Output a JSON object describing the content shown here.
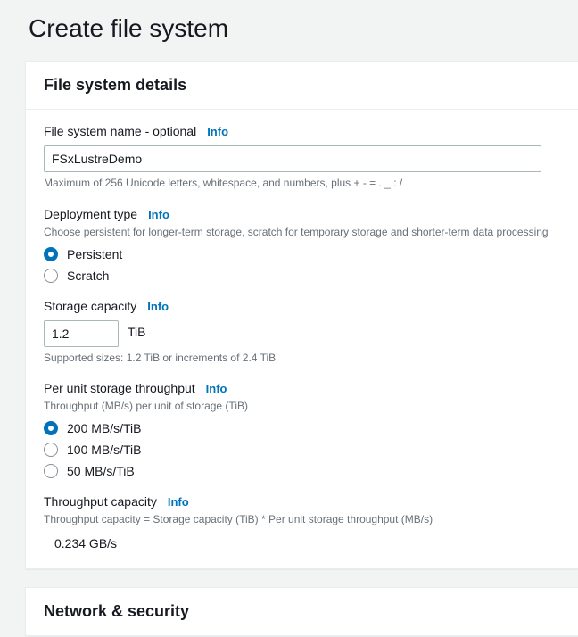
{
  "page": {
    "title": "Create file system"
  },
  "panel1": {
    "title": "File system details",
    "name_field": {
      "label": "File system name - optional",
      "info": "Info",
      "value": "FSxLustreDemo",
      "helper": "Maximum of 256 Unicode letters, whitespace, and numbers, plus + - = . _ : /"
    },
    "deployment": {
      "label": "Deployment type",
      "info": "Info",
      "helper": "Choose persistent for longer-term storage, scratch for temporary storage and shorter-term data processing",
      "options": {
        "persistent": "Persistent",
        "scratch": "Scratch"
      }
    },
    "storage": {
      "label": "Storage capacity",
      "info": "Info",
      "value": "1.2",
      "unit": "TiB",
      "helper": "Supported sizes: 1.2 TiB or increments of 2.4 TiB"
    },
    "throughput_per_unit": {
      "label": "Per unit storage throughput",
      "info": "Info",
      "helper": "Throughput (MB/s) per unit of storage (TiB)",
      "options": {
        "o200": "200 MB/s/TiB",
        "o100": "100 MB/s/TiB",
        "o50": "50 MB/s/TiB"
      }
    },
    "throughput_capacity": {
      "label": "Throughput capacity",
      "info": "Info",
      "helper": "Throughput capacity = Storage capacity (TiB) * Per unit storage throughput (MB/s)",
      "value": "0.234 GB/s"
    }
  },
  "panel2": {
    "title": "Network & security"
  }
}
